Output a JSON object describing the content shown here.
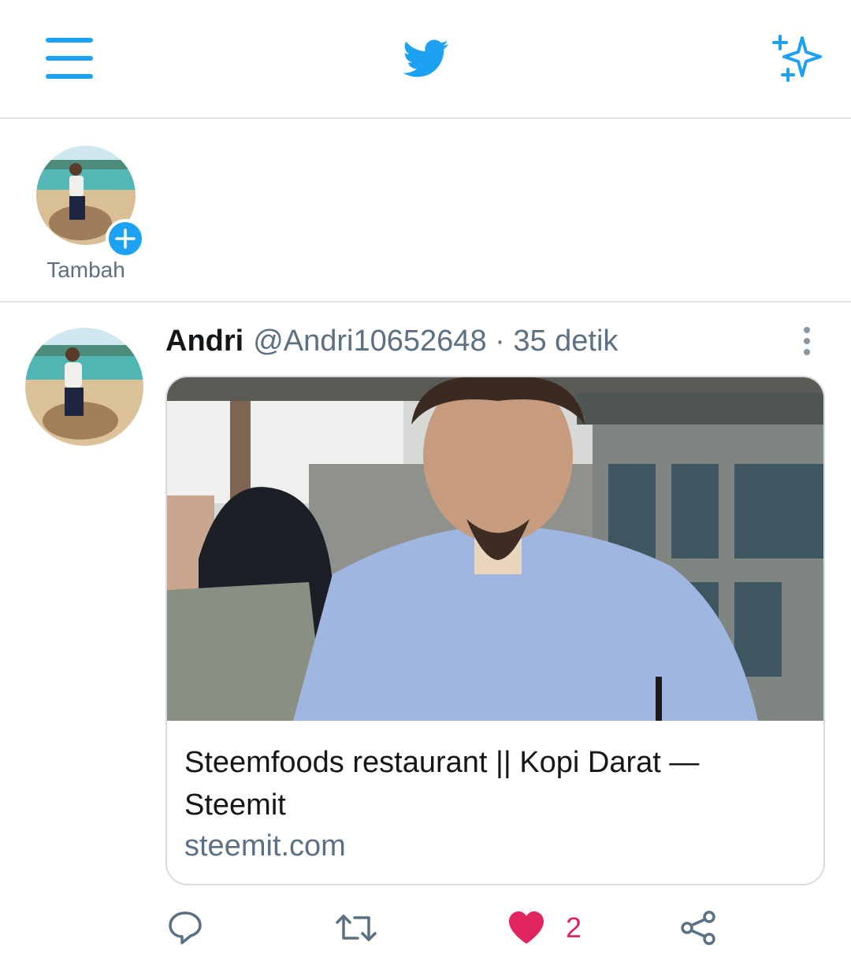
{
  "colors": {
    "brand": "#1da1f2",
    "like": "#e0245e",
    "secondary_text": "#5b7083",
    "primary_text": "#14171a"
  },
  "header": {
    "menu_icon": "hamburger-menu-icon",
    "logo_icon": "twitter-bird-icon",
    "sparkle_icon": "sparkle-top-tweets-icon"
  },
  "fleets": {
    "add_label": "Tambah",
    "add_icon": "plus-icon"
  },
  "tweet": {
    "name": "Andri",
    "meta": "@Andri10652648 · 35 detik",
    "more_icon": "more-vertical-icon",
    "card": {
      "title": "Steemfoods restaurant || Kopi Darat — Steemit",
      "domain": "steemit.com"
    },
    "actions": {
      "reply_icon": "reply-icon",
      "retweet_icon": "retweet-icon",
      "like_icon": "heart-icon",
      "like_count": "2",
      "share_icon": "share-icon"
    }
  }
}
